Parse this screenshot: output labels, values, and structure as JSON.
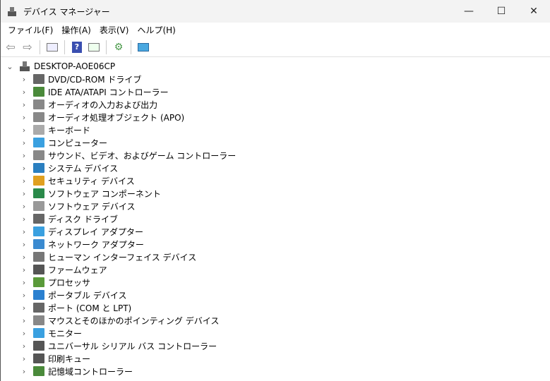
{
  "window": {
    "title": "デバイス マネージャー",
    "minimize": "—",
    "maximize": "☐",
    "close": "✕"
  },
  "menu": [
    "ファイル(F)",
    "操作(A)",
    "表示(V)",
    "ヘルプ(H)"
  ],
  "tree": {
    "root": "DESKTOP-AOE06CP",
    "items": [
      {
        "label": "DVD/CD-ROM ドライブ",
        "icon": "dvd-drive-icon",
        "color": "#666"
      },
      {
        "label": "IDE ATA/ATAPI コントローラー",
        "icon": "ide-controller-icon",
        "color": "#4a8a3a"
      },
      {
        "label": "オーディオの入力および出力",
        "icon": "speaker-icon",
        "color": "#888"
      },
      {
        "label": "オーディオ処理オブジェクト (APO)",
        "icon": "speaker-icon",
        "color": "#888"
      },
      {
        "label": "キーボード",
        "icon": "keyboard-icon",
        "color": "#aaa"
      },
      {
        "label": "コンピューター",
        "icon": "computer-icon",
        "color": "#3aa0e0"
      },
      {
        "label": "サウンド、ビデオ、およびゲーム コントローラー",
        "icon": "speaker-icon",
        "color": "#888"
      },
      {
        "label": "システム デバイス",
        "icon": "system-folder-icon",
        "color": "#2a7fc0"
      },
      {
        "label": "セキュリティ デバイス",
        "icon": "security-key-icon",
        "color": "#e0a020"
      },
      {
        "label": "ソフトウェア コンポーネント",
        "icon": "software-component-icon",
        "color": "#2a8a4a"
      },
      {
        "label": "ソフトウェア デバイス",
        "icon": "software-device-icon",
        "color": "#999"
      },
      {
        "label": "ディスク ドライブ",
        "icon": "disk-drive-icon",
        "color": "#666"
      },
      {
        "label": "ディスプレイ アダプター",
        "icon": "display-adapter-icon",
        "color": "#3aa0e0"
      },
      {
        "label": "ネットワーク アダプター",
        "icon": "network-adapter-icon",
        "color": "#3a8ad0"
      },
      {
        "label": "ヒューマン インターフェイス デバイス",
        "icon": "hid-icon",
        "color": "#777"
      },
      {
        "label": "ファームウェア",
        "icon": "firmware-icon",
        "color": "#555"
      },
      {
        "label": "プロセッサ",
        "icon": "processor-icon",
        "color": "#5a9a3a"
      },
      {
        "label": "ポータブル デバイス",
        "icon": "portable-device-icon",
        "color": "#2a80d0"
      },
      {
        "label": "ポート (COM と LPT)",
        "icon": "port-icon",
        "color": "#666"
      },
      {
        "label": "マウスとそのほかのポインティング デバイス",
        "icon": "mouse-icon",
        "color": "#888"
      },
      {
        "label": "モニター",
        "icon": "monitor-icon",
        "color": "#3aa0e0"
      },
      {
        "label": "ユニバーサル シリアル バス コントローラー",
        "icon": "usb-icon",
        "color": "#555"
      },
      {
        "label": "印刷キュー",
        "icon": "printer-icon",
        "color": "#555"
      },
      {
        "label": "記憶域コントローラー",
        "icon": "storage-controller-icon",
        "color": "#4a8a3a"
      }
    ]
  }
}
